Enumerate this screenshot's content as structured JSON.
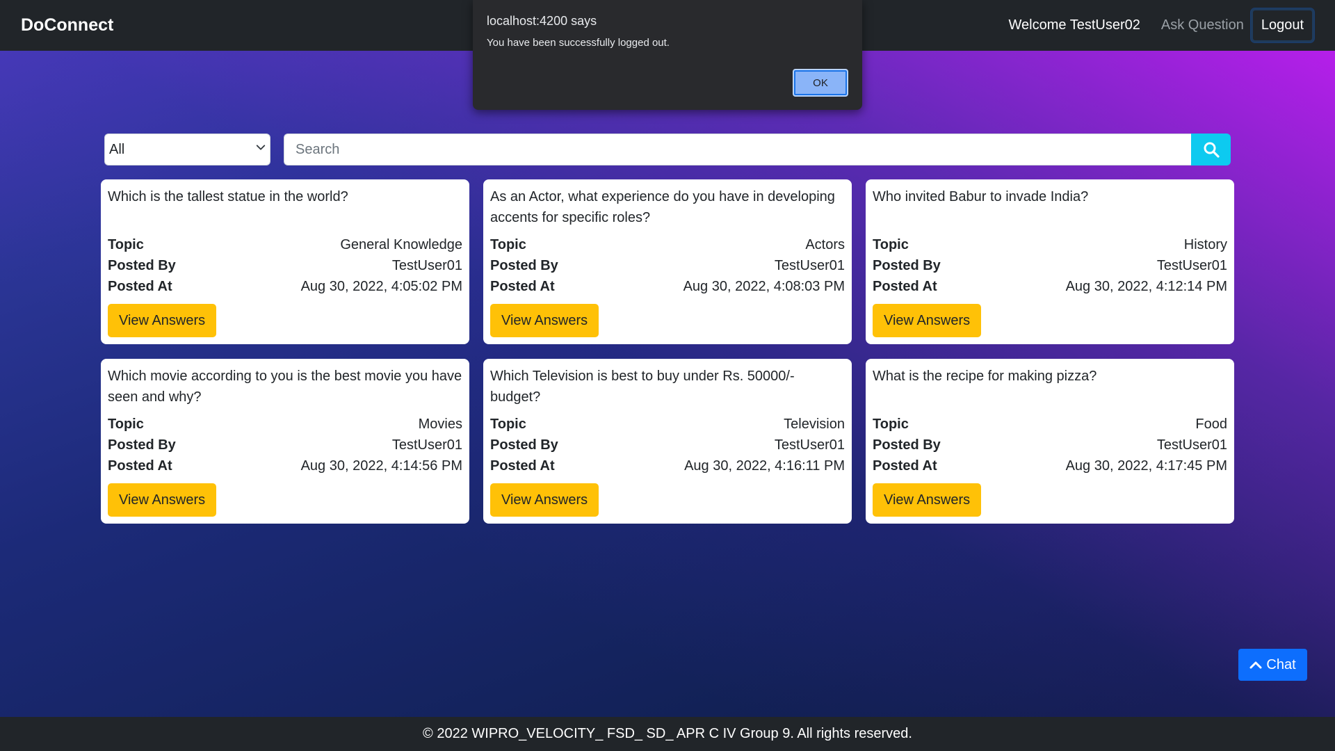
{
  "navbar": {
    "brand": "DoConnect",
    "welcome": "Welcome TestUser02",
    "ask_question": "Ask Question",
    "logout": "Logout"
  },
  "dialog": {
    "title": "localhost:4200 says",
    "message": "You have been successfully logged out.",
    "ok_label": "OK"
  },
  "search": {
    "filter_value": "All",
    "placeholder": "Search",
    "icon": "search-icon"
  },
  "labels": {
    "topic": "Topic",
    "posted_by": "Posted By",
    "posted_at": "Posted At",
    "view_answers": "View Answers"
  },
  "questions": [
    {
      "title": "Which is the tallest statue in the world?",
      "topic": "General Knowledge",
      "posted_by": "TestUser01",
      "posted_at": "Aug 30, 2022, 4:05:02 PM"
    },
    {
      "title": "As an Actor, what experience do you have in developing accents for specific roles?",
      "topic": "Actors",
      "posted_by": "TestUser01",
      "posted_at": "Aug 30, 2022, 4:08:03 PM"
    },
    {
      "title": "Who invited Babur to invade India?",
      "topic": "History",
      "posted_by": "TestUser01",
      "posted_at": "Aug 30, 2022, 4:12:14 PM"
    },
    {
      "title": "Which movie according to you is the best movie you have seen and why?",
      "topic": "Movies",
      "posted_by": "TestUser01",
      "posted_at": "Aug 30, 2022, 4:14:56 PM"
    },
    {
      "title": "Which Television is best to buy under Rs. 50000/- budget?",
      "topic": "Television",
      "posted_by": "TestUser01",
      "posted_at": "Aug 30, 2022, 4:16:11 PM"
    },
    {
      "title": "What is the recipe for making pizza?",
      "topic": "Food",
      "posted_by": "TestUser01",
      "posted_at": "Aug 30, 2022, 4:17:45 PM"
    }
  ],
  "chat": {
    "label": "Chat",
    "icon": "chevron-up-icon"
  },
  "footer": {
    "text": "© 2022 WIPRO_VELOCITY_ FSD_ SD_ APR C IV Group 9. All rights reserved."
  },
  "colors": {
    "navbar": "#212529",
    "search_button": "#0dcaf0",
    "view_button": "#ffc107",
    "chat_button": "#0d6efd",
    "dialog_ok": "#8ab4f8"
  }
}
